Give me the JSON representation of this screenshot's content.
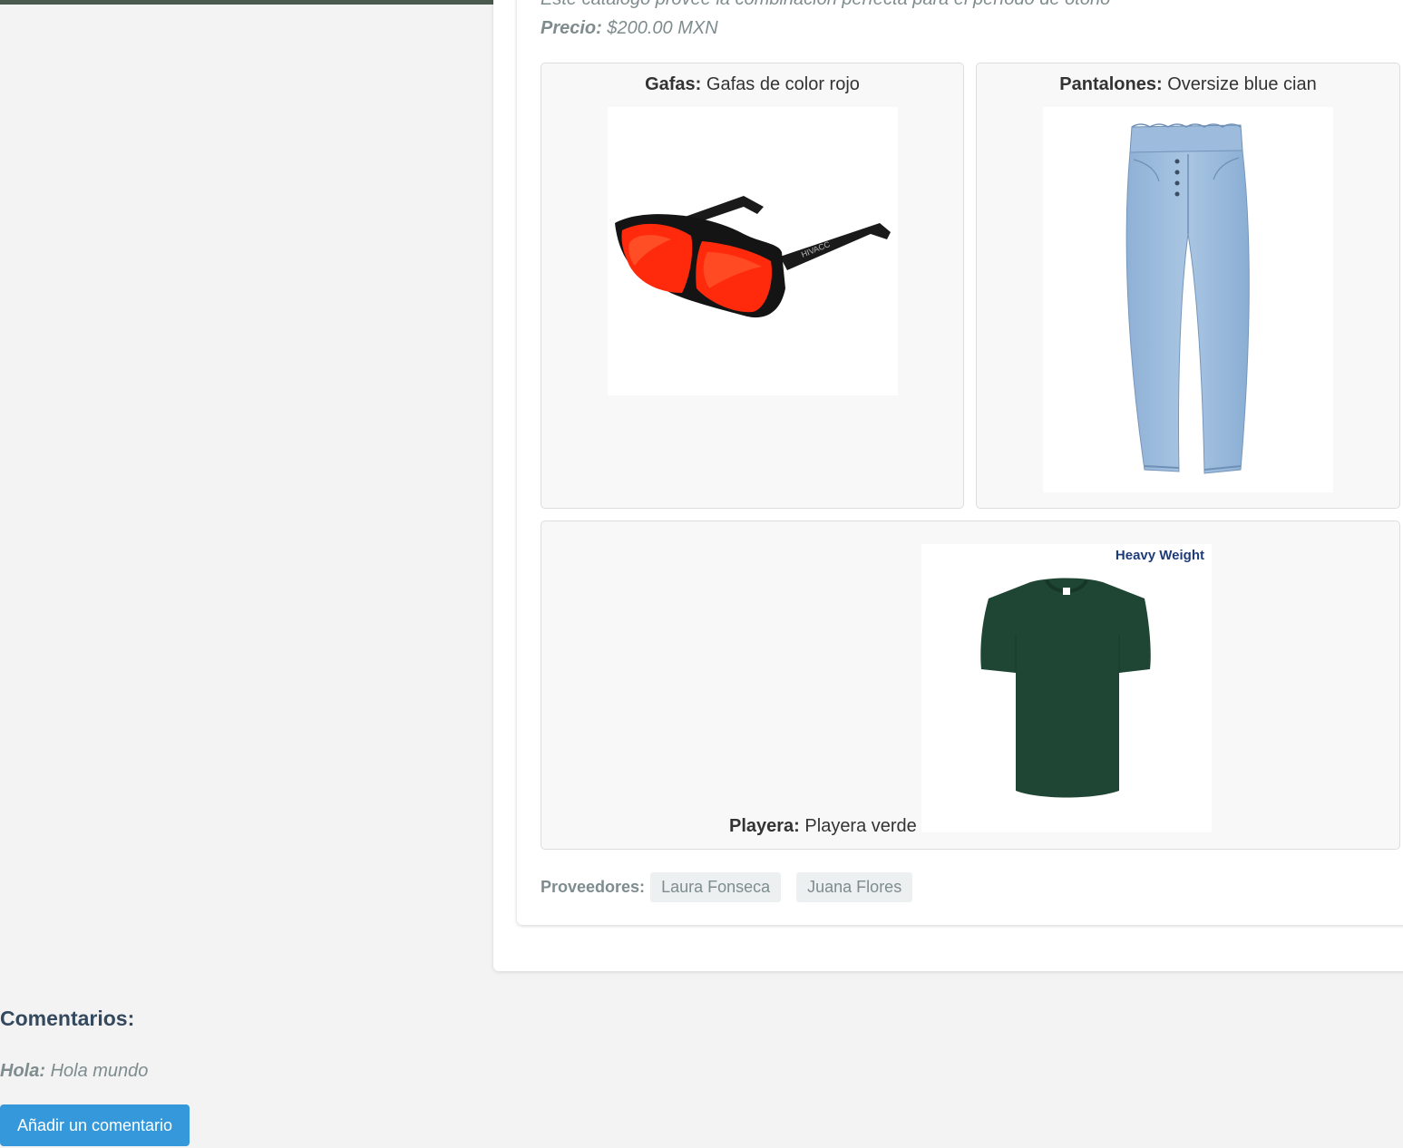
{
  "catalog": {
    "description": "Este catálogo provee la combinación perfecta para el período de otoño",
    "price_label": "Precio:",
    "price_value": "$200.00 MXN"
  },
  "products": [
    {
      "category": "Gafas:",
      "name": "Gafas de color rojo",
      "image": "red-sunglasses"
    },
    {
      "category": "Pantalones:",
      "name": "Oversize blue cian",
      "image": "blue-jeans"
    },
    {
      "category": "Playera:",
      "name": "Playera verde",
      "image": "green-tshirt",
      "image_text": "Heavy Weight"
    }
  ],
  "providers": {
    "label": "Proveedores:",
    "items": [
      "Laura Fonseca",
      "Juana Flores"
    ]
  },
  "comments": {
    "title": "Comentarios:",
    "items": [
      {
        "author": "Hola:",
        "text": "Hola mundo"
      }
    ],
    "add_button_label": "Añadir un comentario"
  },
  "colors": {
    "topbar": "#4a5a4e",
    "button": "#3498db",
    "muted_text": "#7f8c8d",
    "heading": "#34495e"
  }
}
